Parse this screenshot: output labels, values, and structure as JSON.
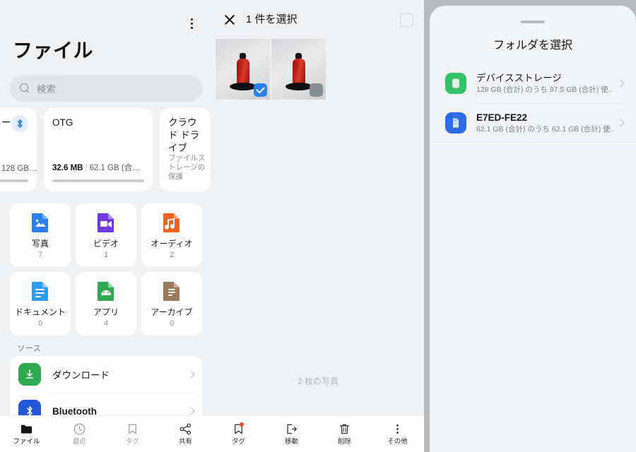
{
  "files_app": {
    "title": "ファイル",
    "overflow_icon": "more-vertical-icon",
    "search": {
      "placeholder": "検索",
      "icon": "search-icon"
    },
    "storage_cards": [
      {
        "title": "ー",
        "badge_icon": "bluetooth-icon",
        "meta_main": "",
        "meta_rest": "128 GB…",
        "desc": "",
        "accent": "#2a7fe8"
      },
      {
        "title": "OTG",
        "badge_icon": "",
        "meta_main": "32.6 MB",
        "meta_rest": "62.1 GB (合…",
        "desc": "",
        "accent": "#8c8f93"
      },
      {
        "title": "クラウド ドライブ",
        "badge_icon": "",
        "meta_main": "",
        "meta_rest": "",
        "desc": "ファイルストレージの保護",
        "accent": "#8c8f93"
      }
    ],
    "categories": [
      {
        "label": "写真",
        "count": "7",
        "icon": "image-file-icon",
        "color": "#2d7ff0"
      },
      {
        "label": "ビデオ",
        "count": "1",
        "icon": "video-file-icon",
        "color": "#7339e0"
      },
      {
        "label": "オーディオ",
        "count": "2",
        "icon": "audio-file-icon",
        "color": "#f0621f"
      },
      {
        "label": "ドキュメント",
        "count": "0",
        "icon": "document-file-icon",
        "color": "#2d9cf0"
      },
      {
        "label": "アプリ",
        "count": "4",
        "icon": "apk-file-icon",
        "color": "#2fa84f"
      },
      {
        "label": "アーカイブ",
        "count": "0",
        "icon": "archive-file-icon",
        "color": "#9a7a5e"
      }
    ],
    "sources_label": "ソース",
    "sources": [
      {
        "label": "ダウンロード",
        "icon": "download-icon",
        "color": "#2fa84f",
        "bold": false
      },
      {
        "label": "Bluetooth",
        "icon": "bluetooth-icon",
        "color": "#2456d8",
        "bold": true
      }
    ]
  },
  "picker": {
    "close_icon": "close-icon",
    "title": "1 件を選択",
    "select_all_icon": "checkbox-unchecked-icon",
    "thumbnails": [
      {
        "name": "photo-thumbnail-1",
        "selected": true
      },
      {
        "name": "photo-thumbnail-2",
        "selected": false
      }
    ],
    "photo_count_text": "2 枚の写真"
  },
  "bottom_bar": {
    "items": [
      {
        "label": "ファイル",
        "icon": "folder-icon",
        "state": "active",
        "badge": false
      },
      {
        "label": "最近",
        "icon": "clock-icon",
        "state": "dim",
        "badge": false
      },
      {
        "label": "タグ",
        "icon": "bookmark-icon",
        "state": "dim",
        "badge": false
      },
      {
        "label": "共有",
        "icon": "share-icon",
        "state": "dark",
        "badge": false
      },
      {
        "label": "タグ",
        "icon": "bookmark-icon",
        "state": "dark",
        "badge": true
      },
      {
        "label": "移動",
        "icon": "move-icon",
        "state": "dark",
        "badge": false
      },
      {
        "label": "削除",
        "icon": "trash-icon",
        "state": "dark",
        "badge": false
      },
      {
        "label": "その他",
        "icon": "more-vertical-icon",
        "state": "dark",
        "badge": false
      }
    ]
  },
  "folder_sheet": {
    "handle": "drag-handle",
    "title": "フォルダを選択",
    "rows": [
      {
        "name": "デバイスストレージ",
        "subtitle": "128 GB (合計) のうち 97.5 GB (合計) 使..",
        "icon": "internal-storage-icon",
        "color": "#34c26a",
        "bold": false
      },
      {
        "name": "E7ED-FE22",
        "subtitle": "62.1 GB (合計) のうち 62.1 GB (合計) 使..",
        "icon": "sd-card-icon",
        "color": "#2d6ce8",
        "bold": true
      }
    ]
  },
  "colors": {
    "page_bg": "#eff1f3",
    "card_bg": "#ffffff",
    "accent_blue": "#2a7fe8",
    "scrim": "#b8babd",
    "badge_red": "#e8452c"
  }
}
